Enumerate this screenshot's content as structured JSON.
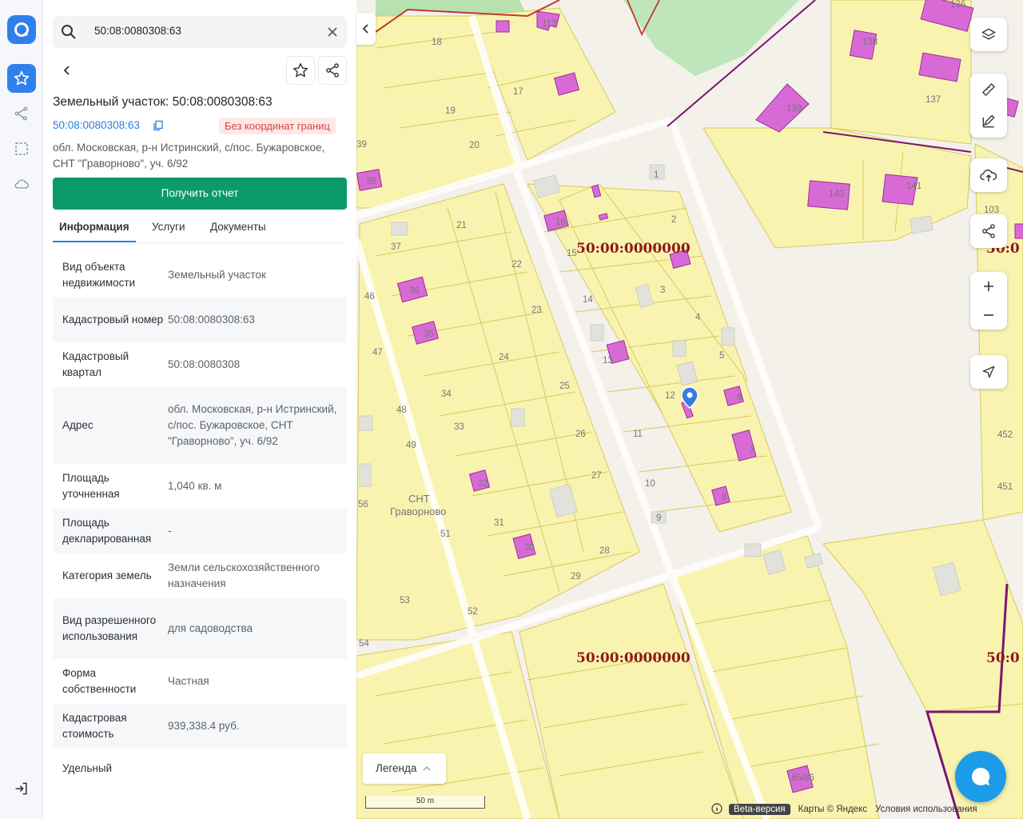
{
  "search": {
    "value": "50:08:0080308:63"
  },
  "header": {
    "title": "Земельный участок: 50:08:0080308:63",
    "cad_number": "50:08:0080308:63",
    "badge": "Без координат границ",
    "address": "обл. Московская, р-н Истринский, с/пос. Бужаровское, СНТ \"Граворново\", уч. 6/92",
    "report_button": "Получить отчет"
  },
  "tabs": [
    {
      "label": "Информация",
      "active": true
    },
    {
      "label": "Услуги"
    },
    {
      "label": "Документы"
    }
  ],
  "info_rows": [
    {
      "key": "Вид объекта недвижимости",
      "value": "Земельный участок"
    },
    {
      "key": "Кадастровый номер",
      "value": "50:08:0080308:63"
    },
    {
      "key": "Кадастровый квартал",
      "value": "50:08:0080308"
    },
    {
      "key": "Адрес",
      "value": "обл. Московская, р-н Истринский, с/пос. Бужаровское, СНТ \"Граворново\", уч. 6/92"
    },
    {
      "key": "Площадь уточненная",
      "value": "1,040 кв. м"
    },
    {
      "key": "Площадь декларированная",
      "value": "-"
    },
    {
      "key": "Категория земель",
      "value": "Земли сельскохозяйственного назначения"
    },
    {
      "key": "Вид разрешенного использования",
      "value": "для садоводства"
    },
    {
      "key": "Форма собственности",
      "value": "Частная"
    },
    {
      "key": "Кадастровая стоимость",
      "value": "939,338.4 руб."
    },
    {
      "key": "Удельный",
      "value": ""
    }
  ],
  "map": {
    "quarter_label": "50:00:0000000",
    "quarter_label_right": "50:0",
    "snt_label": "СНТ",
    "snt_name": "Граворново",
    "legend": "Легенда",
    "scale": "50 m",
    "beta": "Beta-версия",
    "maps_credit": "Карты © Яндекс",
    "terms": "Условия использования",
    "parcel_numbers": [
      "18",
      "19",
      "20",
      "17",
      "1",
      "2",
      "3",
      "4",
      "5",
      "6",
      "7",
      "8",
      "9",
      "10",
      "11",
      "12",
      "13",
      "14",
      "15",
      "16",
      "21",
      "22",
      "23",
      "24",
      "25",
      "26",
      "27",
      "28",
      "29",
      "30",
      "31",
      "32",
      "33",
      "34",
      "35",
      "36",
      "37",
      "38",
      "39",
      "46",
      "47",
      "48",
      "49",
      "51",
      "52",
      "53",
      "54",
      "56",
      "85/86",
      "103",
      "112",
      "136",
      "137",
      "138",
      "139",
      "140",
      "141",
      "451",
      "452"
    ]
  },
  "colors": {
    "accent": "#2f80ed",
    "report": "#0b9a6b",
    "parcel": "#f9f3b0",
    "parcel_border": "#d8c95a",
    "building": "#d86ad6"
  }
}
